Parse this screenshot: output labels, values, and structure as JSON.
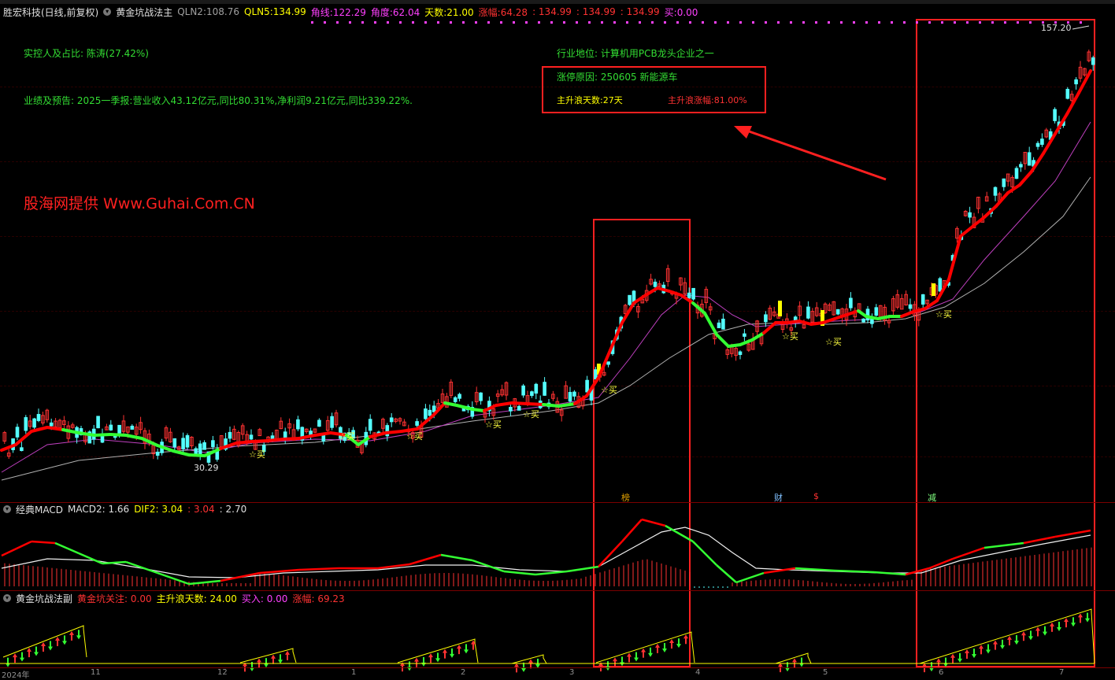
{
  "header": {
    "stock_name": "胜宏科技(日线,前复权)",
    "indicator": "黄金坑战法主",
    "qln2_label": "QLN2:",
    "qln2_value": "108.76",
    "qln5_label": "QLN5:",
    "qln5_value": "134.99",
    "jiaoxian_label": "角线:",
    "jiaoxian_value": "122.29",
    "jiaodu_label": "角度:",
    "jiaodu_value": "62.04",
    "tianshu_label": "天数:",
    "tianshu_value": "21.00",
    "zhangfu_label": "涨幅:",
    "zhangfu_value": "64.28",
    "v1": ": 134.99",
    "v2": ": 134.99",
    "v3": ": 134.99",
    "mai_label": "买:",
    "mai_value": "0.00"
  },
  "info": {
    "controller": "实控人及占比: 陈涛(27.42%)",
    "earnings": "业绩及预告: 2025一季报:营业收入43.12亿元,同比80.31%,净利润9.21亿元,同比339.22%.",
    "industry": "行业地位: 计算机用PCB龙头企业之一",
    "limit_reason": "涨停原因: 250605 新能源车",
    "wave_days": "主升浪天数:27天",
    "wave_gain": "主升浪涨幅:81.00%",
    "watermark": "股海网提供 Www.Guhai.Com.CN"
  },
  "price_labels": {
    "high": "157.20",
    "low": "30.29"
  },
  "buy_signal": "☆买",
  "buy_signals": [
    "☆买",
    "☆买",
    "☆买",
    "☆买",
    "☆买",
    "☆买",
    "☆买",
    "☆买",
    "☆买",
    "☆买",
    "☆买"
  ],
  "event_tags": {
    "bang": "榜",
    "cai": "财",
    "dollar": "$",
    "jian": "减"
  },
  "macd": {
    "name": "经典MACD",
    "macd2_label": "MACD2:",
    "macd2_value": "1.66",
    "dif2_label": "DIF2:",
    "dif2_value": "3.04",
    "v1": ": 3.04",
    "v2": ": 2.70"
  },
  "sub": {
    "name": "黄金坑战法副",
    "focus_label": "黄金坑关注:",
    "focus_value": "0.00",
    "days_label": "主升浪天数:",
    "days_value": "24.00",
    "buy_label": "买入:",
    "buy_value": "0.00",
    "gain_label": "涨幅:",
    "gain_value": "69.23"
  },
  "x_axis": [
    "2024年",
    "11",
    "12",
    "1",
    "2",
    "3",
    "4",
    "5",
    "6",
    "7"
  ],
  "colors": {
    "up": "#ff3232",
    "down": "#54ffff",
    "ma_fast_up": "#ff0000",
    "ma_fast_down": "#33ff33",
    "ma_mid": "#c040c0",
    "ma_slow": "#b0b0b0",
    "box": "#ff2020",
    "yellow": "#ffff00"
  }
}
